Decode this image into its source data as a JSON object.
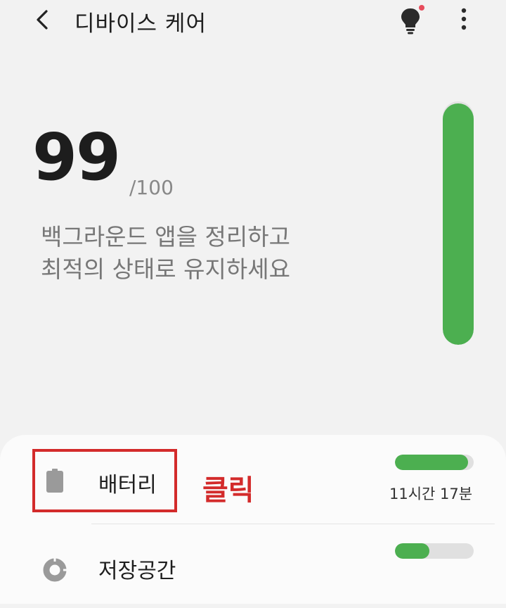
{
  "header": {
    "title": "디바이스 케어",
    "back_icon": "chevron-left-icon",
    "tips_icon": "lightbulb-icon",
    "more_icon": "more-vertical-icon",
    "notification_dot_color": "#e74c5c"
  },
  "score": {
    "value": "99",
    "max": "/100",
    "message_line1": "백그라운드 앱을 정리하고",
    "message_line2": "최적의 상태로 유지하세요",
    "gauge_level": 0.99,
    "gauge_color": "#4caf50"
  },
  "items": {
    "battery": {
      "label": "배터리",
      "icon": "battery-icon",
      "level": 0.93,
      "time_left": "11시간 17분"
    },
    "storage": {
      "label": "저장공간",
      "icon": "pie-chart-icon",
      "level": 0.44
    }
  },
  "annotation": {
    "text": "클릭",
    "color": "#d32b2b"
  }
}
